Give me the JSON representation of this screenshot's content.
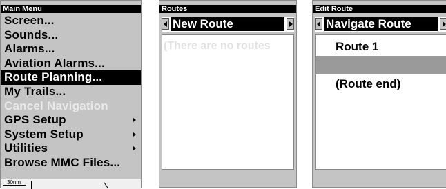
{
  "main_menu": {
    "title": "Main Menu",
    "items": [
      {
        "label": "Screen...",
        "state": "normal",
        "has_submenu": false
      },
      {
        "label": "Sounds...",
        "state": "normal",
        "has_submenu": false
      },
      {
        "label": "Alarms...",
        "state": "normal",
        "has_submenu": false
      },
      {
        "label": "Aviation Alarms...",
        "state": "normal",
        "has_submenu": false
      },
      {
        "label": "Route Planning...",
        "state": "selected",
        "has_submenu": false
      },
      {
        "label": "My Trails...",
        "state": "normal",
        "has_submenu": false
      },
      {
        "label": "Cancel Navigation",
        "state": "disabled",
        "has_submenu": false
      },
      {
        "label": "GPS Setup",
        "state": "normal",
        "has_submenu": true
      },
      {
        "label": "System Setup",
        "state": "normal",
        "has_submenu": true
      },
      {
        "label": "Utilities",
        "state": "normal",
        "has_submenu": true
      },
      {
        "label": "Browse MMC Files...",
        "state": "normal",
        "has_submenu": false
      }
    ],
    "map_scale_label": "30nm"
  },
  "routes": {
    "title": "Routes",
    "selector_value": "New Route",
    "empty_message": "(There are no routes"
  },
  "edit_route": {
    "title": "Edit Route",
    "selector_value": "Navigate Route",
    "rows": [
      "Route 1",
      "",
      "(Route end)"
    ]
  },
  "colors": {
    "panel_gray": "#c4c4c4",
    "highlight": "#000000",
    "list_background": "#ffffff",
    "disabled_text": "#e9e9e9",
    "selected_row_gray": "#9a9a9a"
  }
}
